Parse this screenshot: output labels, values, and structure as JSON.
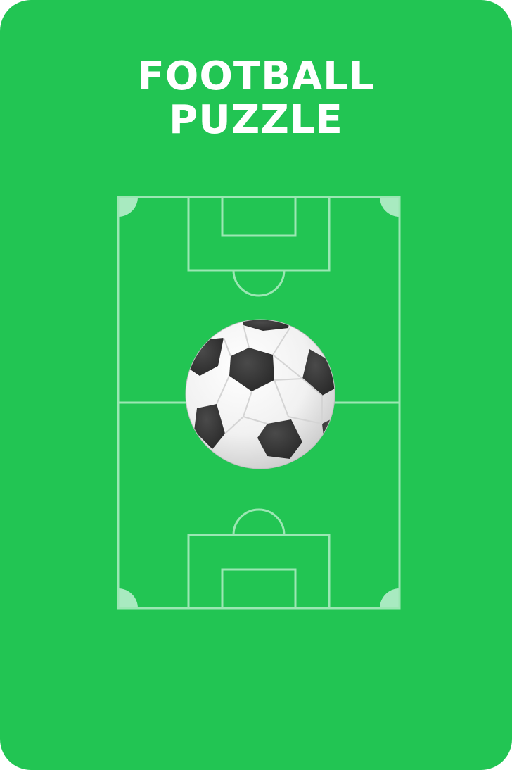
{
  "colors": {
    "background": "#22c553",
    "pitch_lines": "#9be7b3",
    "corner_fill": "#a8eac0",
    "title_text": "#ffffff",
    "ball_white": "#f7f7f7",
    "ball_black": "#2f2f2f"
  },
  "title": {
    "line1": "FOOTBALL",
    "line2": "PUZZLE"
  },
  "pitch": {
    "icon": "football-pitch"
  },
  "ball": {
    "icon": "soccer-ball-icon"
  }
}
